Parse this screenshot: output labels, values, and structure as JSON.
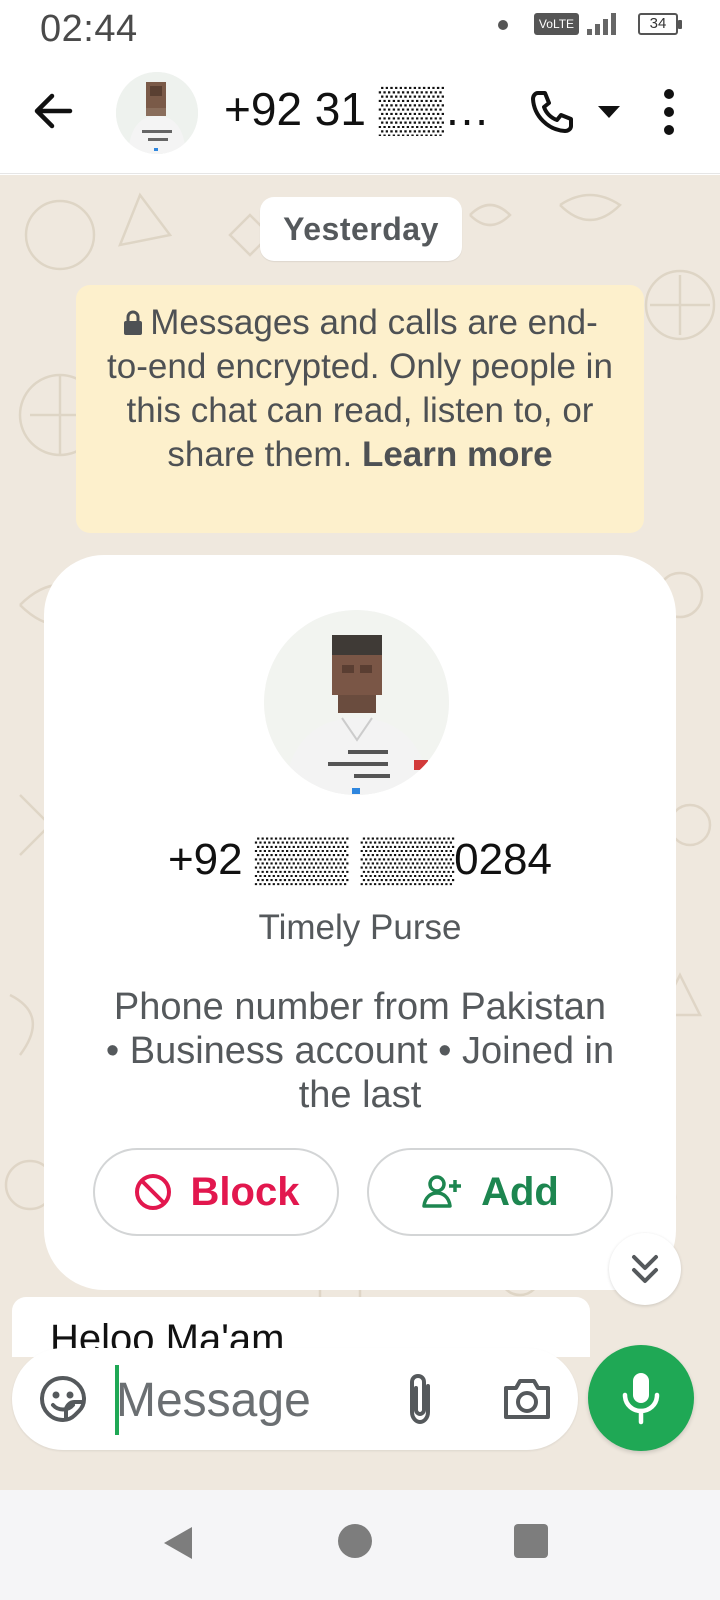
{
  "status_bar": {
    "time": "02:44",
    "network_badge": "VoLTE",
    "battery": "34",
    "icons": [
      "notification-dot-icon",
      "signal-icon",
      "battery-icon"
    ]
  },
  "header": {
    "contact_name": "+92 31 ▒▒▒▒▒…",
    "icons": [
      "back-arrow-icon",
      "phone-icon",
      "caret-down-icon",
      "more-vertical-icon"
    ]
  },
  "chat": {
    "date_chip": "Yesterday",
    "encryption": {
      "text": "Messages and calls are end-to-end encrypted. Only people in this chat can read, listen to, or share them.",
      "link": "Learn more"
    },
    "profile_card": {
      "phone": "+92 ▒▒▒ ▒▒▒0284",
      "name": "Timely Purse",
      "details": "Phone number from Pakistan • Business account • Joined in the last",
      "block_label": "Block",
      "add_label": "Add"
    },
    "last_message": "Heloo Ma'am"
  },
  "input": {
    "placeholder": "Message"
  },
  "colors": {
    "accent_green": "#1fa855",
    "block_red": "#e2174e",
    "add_green": "#1d8650",
    "chat_bg": "#efe8de",
    "encryption_bg": "#fdf0cc"
  }
}
